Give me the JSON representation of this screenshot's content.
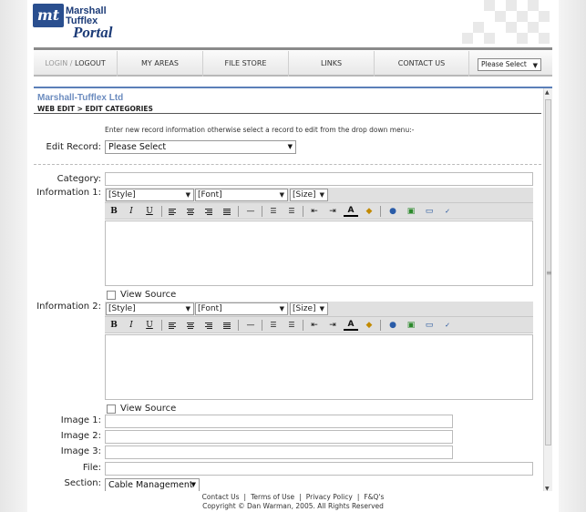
{
  "logo": {
    "line1": "Marshall",
    "line2": "Tufflex",
    "line3": "Portal",
    "mark": "mt"
  },
  "nav": {
    "login": "LOGIN /",
    "logout": "LOGOUT",
    "items": [
      "MY AREAS",
      "FILE STORE",
      "LINKS",
      "CONTACT US"
    ],
    "select_value": "Please Select"
  },
  "panel": {
    "company": "Marshall-Tufflex Ltd",
    "breadcrumb": "WEB EDIT > EDIT CATEGORIES",
    "instruction": "Enter new record information otherwise select a record to edit from the drop down menu:-"
  },
  "form": {
    "edit_record_label": "Edit Record:",
    "edit_record_value": "Please Select",
    "category_label": "Category:",
    "info1_label": "Information 1:",
    "info2_label": "Information 2:",
    "style_value": "[Style]",
    "font_value": "[Font]",
    "size_value": "[Size]",
    "view_source": "View Source",
    "image1_label": "Image 1:",
    "image2_label": "Image 2:",
    "image3_label": "Image 3:",
    "file_label": "File:",
    "section_label": "Section:",
    "section_value": "Cable Management"
  },
  "toolbar_icons": [
    "bold-icon",
    "italic-icon",
    "underline-icon",
    "align-left-icon",
    "align-center-icon",
    "align-right-icon",
    "justify-icon",
    "horizontal-rule-icon",
    "ordered-list-icon",
    "unordered-list-icon",
    "outdent-icon",
    "indent-icon",
    "font-color-icon",
    "highlight-icon",
    "link-icon",
    "image-icon",
    "table-icon",
    "spellcheck-icon"
  ],
  "footer": {
    "links": [
      "Contact Us",
      "Terms of Use",
      "Privacy Policy",
      "F&Q's"
    ],
    "separator": "|",
    "copyright": "Copyright © Dan Warman, 2005. All Rights Reserved"
  },
  "colors": {
    "accent": "#5b7fb8",
    "company": "#6c8cbf",
    "logo": "#1d3c78"
  }
}
